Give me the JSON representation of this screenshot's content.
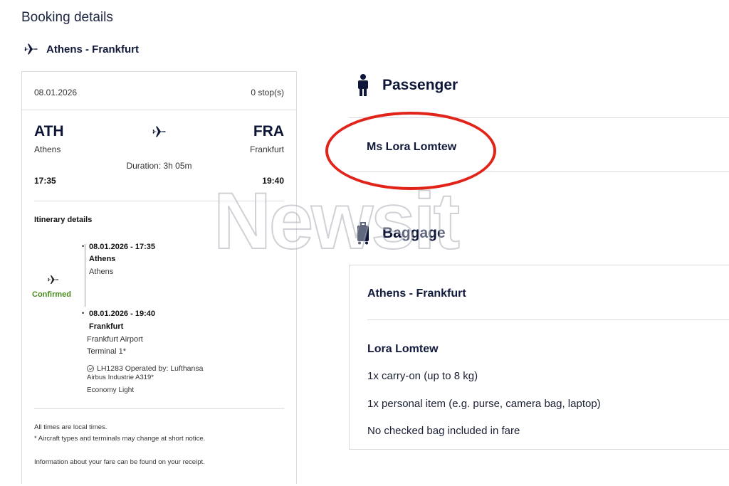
{
  "page": {
    "title": "Booking details",
    "route": "Athens - Frankfurt"
  },
  "flight": {
    "date": "08.01.2026",
    "stops": "0 stop(s)",
    "origin": {
      "code": "ATH",
      "city": "Athens",
      "time": "17:35"
    },
    "destination": {
      "code": "FRA",
      "city": "Frankfurt",
      "time": "19:40"
    },
    "duration": "Duration: 3h 05m"
  },
  "itinerary": {
    "title": "Itinerary details",
    "status": "Confirmed",
    "status_color": "#4a8a1f",
    "departure": {
      "datetime": "08.01.2026 - 17:35",
      "city": "Athens",
      "airport": "Athens"
    },
    "arrival": {
      "datetime": "08.01.2026 - 19:40",
      "city": "Frankfurt",
      "airport": "Frankfurt Airport",
      "terminal": "Terminal 1*"
    },
    "flight_info": "LH1283 Operated by: Lufthansa",
    "aircraft": "Airbus Industrie A319*",
    "fare": "Economy Light"
  },
  "notes": {
    "local_times": "All times are local times.",
    "changes": "* Aircraft types and terminals may change at short notice.",
    "receipt": "Information about your fare can be found on your receipt."
  },
  "passenger": {
    "heading": "Passenger",
    "name": "Ms Lora Lomtew",
    "highlight_color": "#e2231a"
  },
  "baggage": {
    "heading": "Baggage",
    "route": "Athens - Frankfurt",
    "passenger": "Lora Lomtew",
    "items": [
      "1x carry-on (up to 8 kg)",
      "1x personal item (e.g. purse, camera bag, laptop)",
      "No checked bag included in fare"
    ]
  },
  "watermark": {
    "text": "Newsit"
  },
  "icons": [
    "plane-icon",
    "person-icon",
    "suitcase-icon",
    "check-circle-icon"
  ]
}
